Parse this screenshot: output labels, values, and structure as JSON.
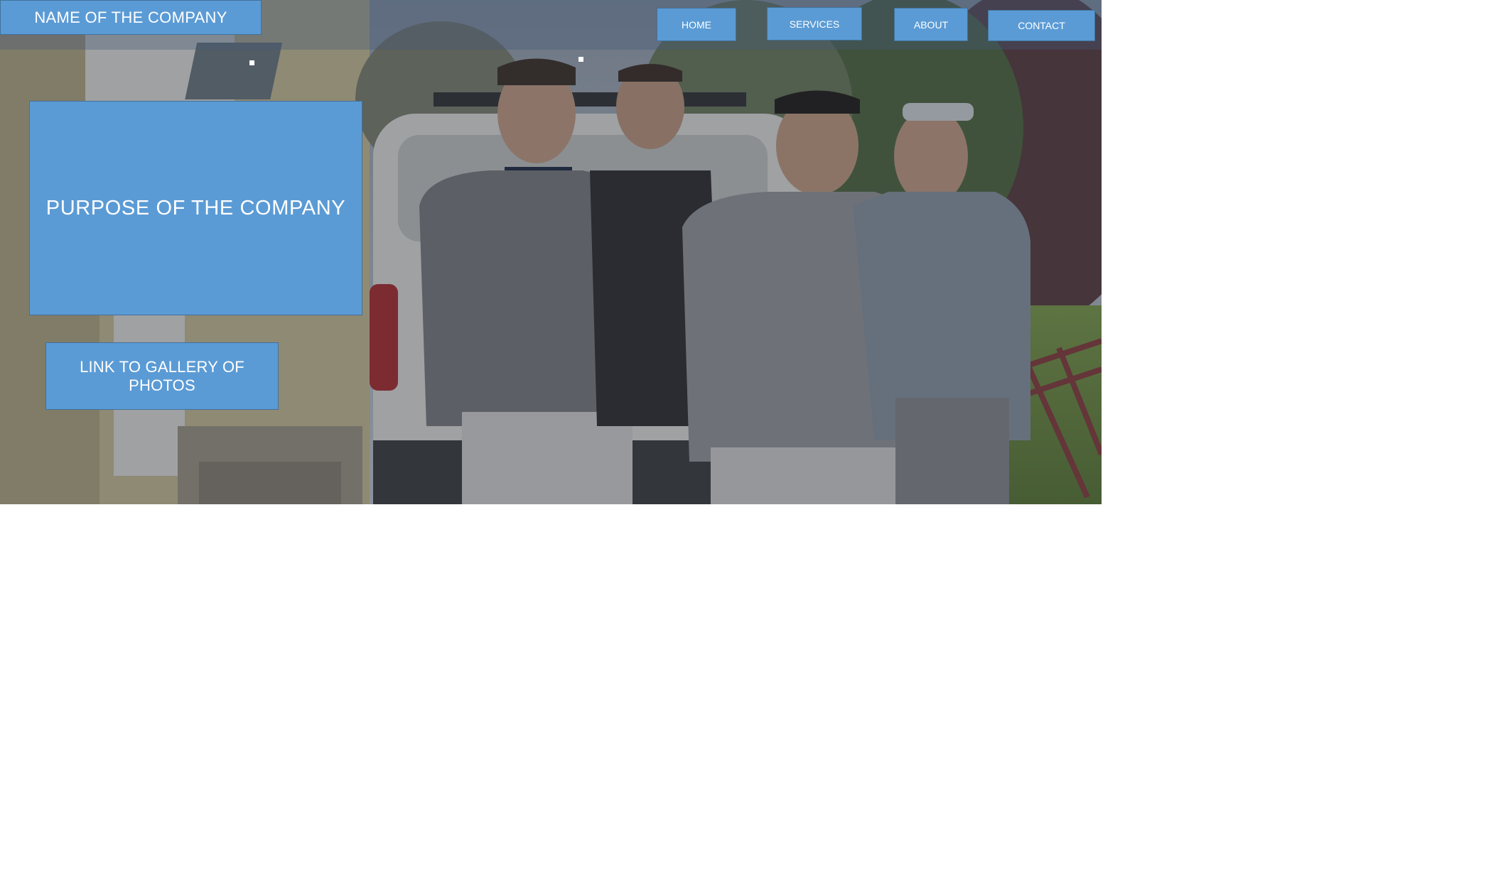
{
  "header": {
    "company_name": "NAME OF THE COMPANY"
  },
  "nav": {
    "home": "HOME",
    "services": "SERVICES",
    "about": "ABOUT",
    "contact": "CONTACT"
  },
  "hero": {
    "purpose": "PURPOSE OF THE COMPANY",
    "gallery_link": "LINK TO GALLERY OF PHOTOS"
  },
  "colors": {
    "accent": "#5b9bd5",
    "accent_border": "#41719c"
  }
}
